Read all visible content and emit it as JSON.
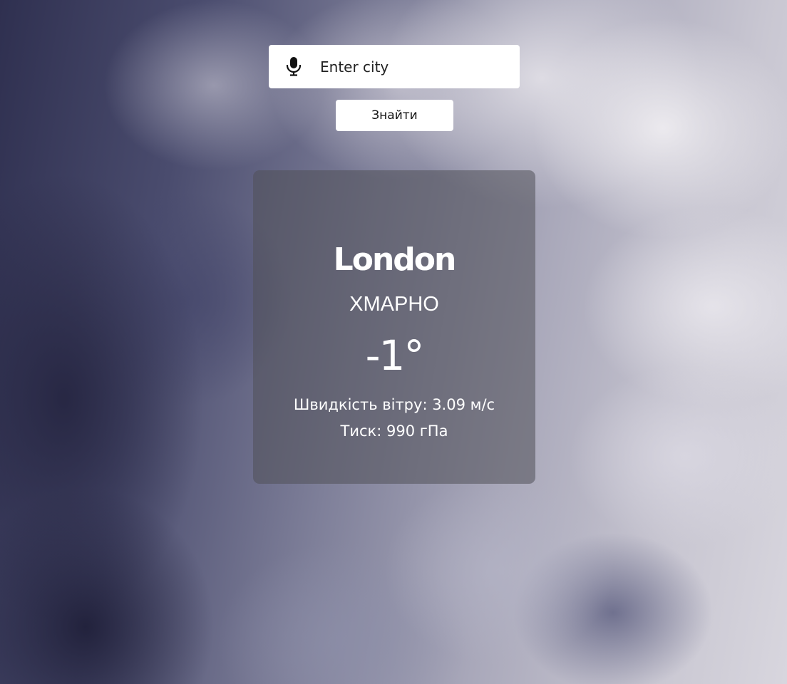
{
  "search": {
    "placeholder": "Enter city",
    "mic_icon": "microphone-icon",
    "button_label": "Знайти"
  },
  "weather": {
    "city": "London",
    "description": "ХМАРНО",
    "temperature": "-1°",
    "wind": "Швидкість вітру: 3.09 м/с",
    "pressure": "Тиск: 990 гПа"
  },
  "colors": {
    "card_background": "#505058",
    "text": "#ffffff",
    "input_background": "#ffffff"
  }
}
